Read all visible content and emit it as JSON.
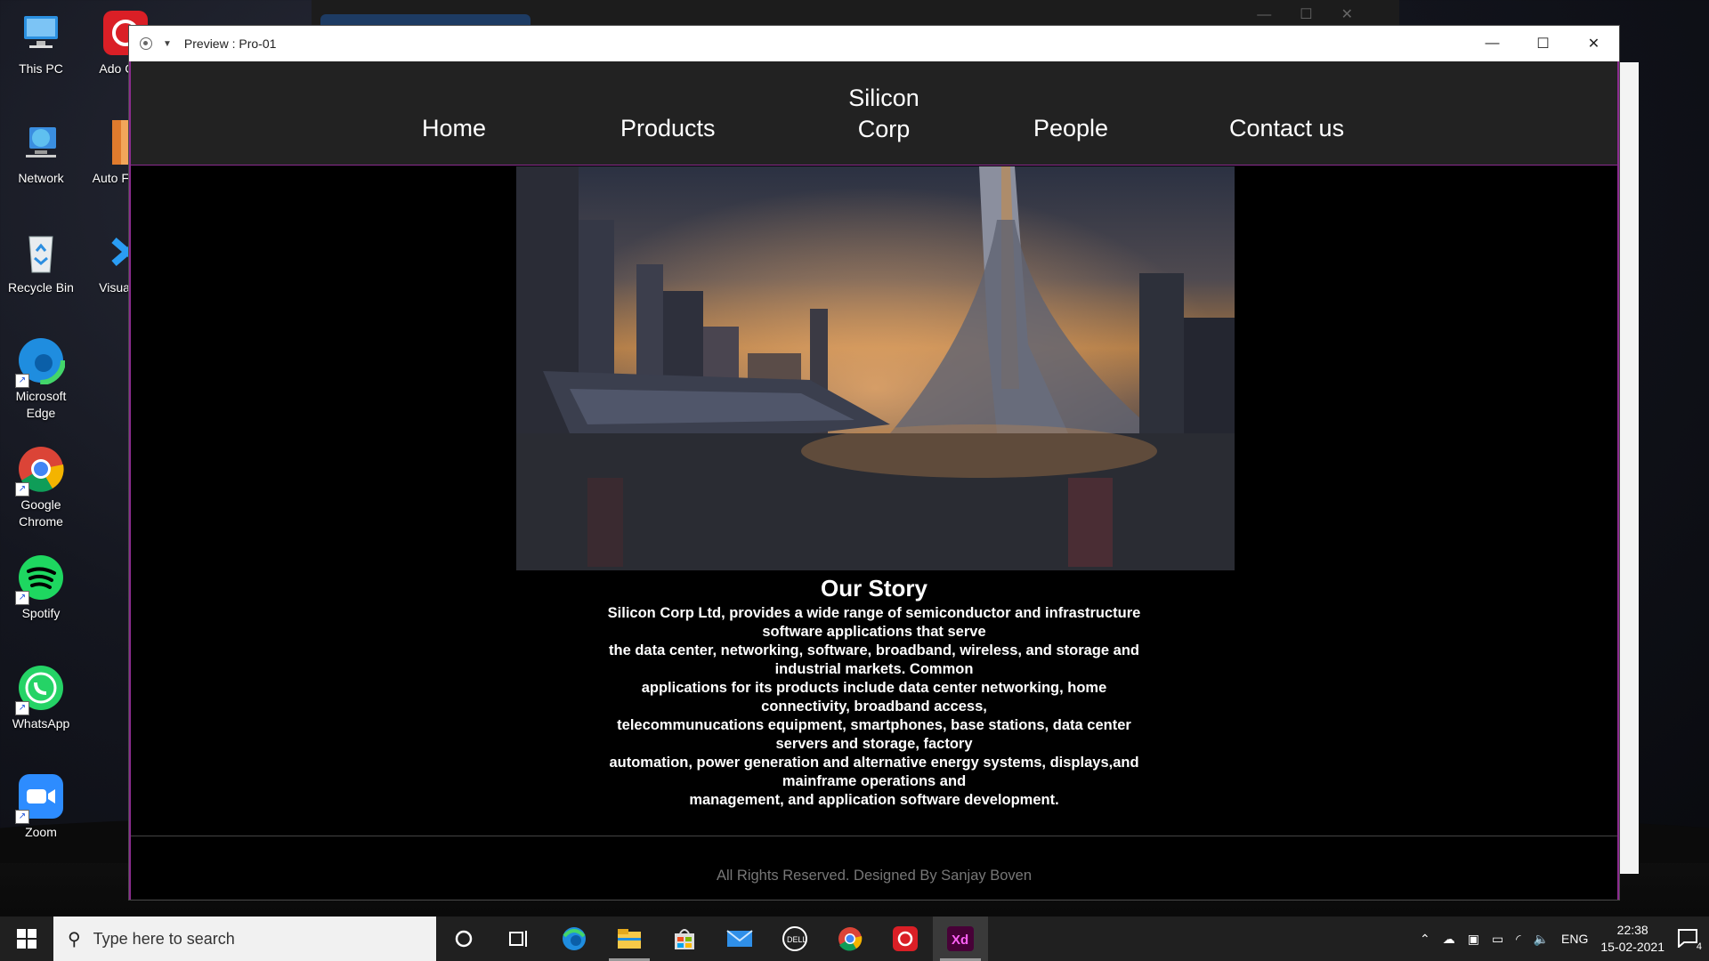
{
  "desktop": {
    "icons": [
      {
        "label": "This PC"
      },
      {
        "label": "Network"
      },
      {
        "label": "Recycle Bin"
      },
      {
        "label": "Microsoft Edge"
      },
      {
        "label": "Google Chrome"
      },
      {
        "label": "Spotify"
      },
      {
        "label": "WhatsApp"
      },
      {
        "label": "Zoom"
      },
      {
        "label": "Ado Crea"
      },
      {
        "label": "Auto Fusion"
      },
      {
        "label": "Visual Co"
      }
    ]
  },
  "window": {
    "title": "Preview : Pro-01",
    "controls": {
      "minimize": "—",
      "maximize": "☐",
      "close": "✕"
    }
  },
  "site": {
    "nav": {
      "home": "Home",
      "products": "Products",
      "brand_line1": "Silicon",
      "brand_line2": "Corp",
      "people": "People",
      "contact": "Contact us"
    },
    "story": {
      "heading": "Our Story",
      "lines": [
        "Silicon Corp Ltd, provides a wide range of semiconductor and infrastructure",
        "software applications that serve",
        "the data center, networking, software, broadband, wireless, and storage and",
        "industrial markets. Common",
        "applications for its products include data center networking, home",
        "connectivity, broadband access,",
        "telecommunucations equipment, smartphones, base stations, data center",
        "servers and storage, factory",
        "automation, power generation and alternative energy systems, displays,and",
        "mainframe operations and",
        "management, and application software development."
      ]
    },
    "footer": "All Rights Reserved. Designed By Sanjay Boven"
  },
  "taskbar": {
    "search_placeholder": "Type here to search",
    "apps": [
      "cortana-icon",
      "task-view-icon",
      "edge-icon",
      "file-explorer-icon",
      "store-icon",
      "mail-icon",
      "dell-icon",
      "chrome-icon",
      "creative-cloud-icon",
      "xd-icon"
    ],
    "tray": {
      "lang": "ENG",
      "time": "22:38",
      "date": "15-02-2021",
      "notifications": "4"
    }
  }
}
